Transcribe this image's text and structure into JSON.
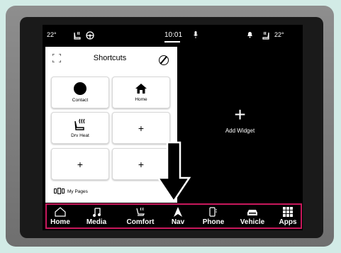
{
  "status": {
    "left_temp": "22°",
    "clock": "10:01",
    "right_temp": "22°"
  },
  "shortcuts": {
    "title": "Shortcuts",
    "tiles": [
      {
        "label": "Contact",
        "icon": "contact-dot-icon"
      },
      {
        "label": "Home",
        "icon": "home-icon"
      },
      {
        "label": "Drv Heat",
        "icon": "seat-heat-icon"
      },
      {
        "label": "+",
        "icon": "add-icon"
      },
      {
        "label": "+",
        "icon": "add-icon"
      },
      {
        "label": "+",
        "icon": "add-icon"
      }
    ],
    "my_pages": "My Pages"
  },
  "widget": {
    "plus": "+",
    "label": "Add Widget"
  },
  "nav": {
    "items": [
      {
        "label": "Home",
        "icon": "home-outline-icon"
      },
      {
        "label": "Media",
        "icon": "music-note-icon"
      },
      {
        "label": "Comfort",
        "icon": "seat-icon"
      },
      {
        "label": "Nav",
        "icon": "navigation-arrow-icon"
      },
      {
        "label": "Phone",
        "icon": "phone-icon"
      },
      {
        "label": "Vehicle",
        "icon": "car-icon"
      },
      {
        "label": "Apps",
        "icon": "apps-grid-icon"
      }
    ]
  },
  "colors": {
    "screen_bg": "#000000",
    "panel_bg": "#ffffff",
    "highlight_border": "#c8185c",
    "backdrop": "#d2ebe6"
  }
}
